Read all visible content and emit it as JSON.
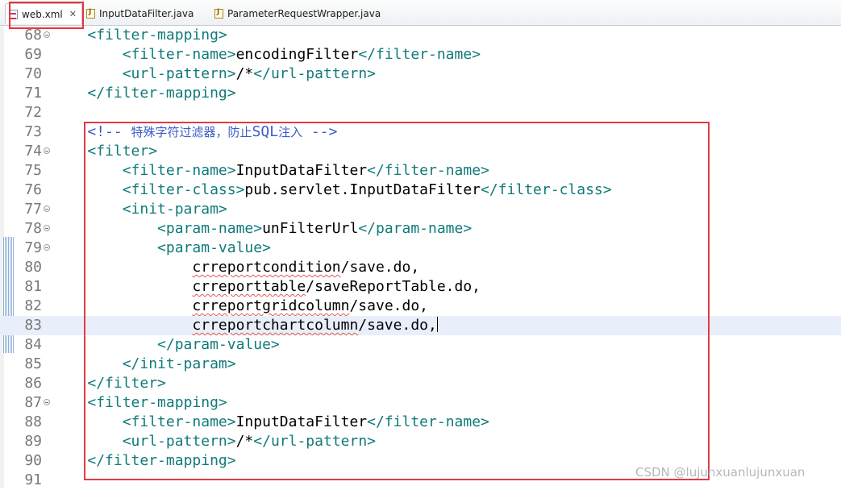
{
  "tabs": [
    {
      "label": "web.xml",
      "icon": "xml-file-icon",
      "close": "✕",
      "active": true
    },
    {
      "label": "InputDataFilter.java",
      "icon": "java-file-icon"
    },
    {
      "label": "ParameterRequestWrapper.java",
      "icon": "java-file-icon"
    }
  ],
  "editor": {
    "current_line": "83",
    "lines": [
      {
        "n": "68",
        "fold": true,
        "indent": "    ",
        "parts": [
          [
            "tag",
            "<filter-mapping>"
          ]
        ]
      },
      {
        "n": "69",
        "fold": false,
        "indent": "        ",
        "parts": [
          [
            "tag",
            "<filter-name>"
          ],
          [
            "txt",
            "encodingFilter"
          ],
          [
            "tag",
            "</filter-name>"
          ]
        ]
      },
      {
        "n": "70",
        "fold": false,
        "indent": "        ",
        "parts": [
          [
            "tag",
            "<url-pattern>"
          ],
          [
            "txt",
            "/*"
          ],
          [
            "tag",
            "</url-pattern>"
          ]
        ]
      },
      {
        "n": "71",
        "fold": false,
        "indent": "    ",
        "parts": [
          [
            "tag",
            "</filter-mapping>"
          ]
        ]
      },
      {
        "n": "72",
        "fold": false,
        "indent": "",
        "parts": []
      },
      {
        "n": "73",
        "fold": false,
        "indent": "    ",
        "parts": [
          [
            "cmt",
            "<!-- "
          ],
          [
            "cjk",
            "特殊字符过滤器，防止"
          ],
          [
            "cmt",
            "SQL"
          ],
          [
            "cjk",
            "注入"
          ],
          [
            "cmt",
            " -->"
          ]
        ]
      },
      {
        "n": "74",
        "fold": true,
        "indent": "    ",
        "parts": [
          [
            "tag",
            "<filter>"
          ]
        ]
      },
      {
        "n": "75",
        "fold": false,
        "indent": "        ",
        "parts": [
          [
            "tag",
            "<filter-name>"
          ],
          [
            "txt",
            "InputDataFilter"
          ],
          [
            "tag",
            "</filter-name>"
          ]
        ]
      },
      {
        "n": "76",
        "fold": false,
        "indent": "        ",
        "parts": [
          [
            "tag",
            "<filter-class>"
          ],
          [
            "txt",
            "pub.servlet.InputDataFilter"
          ],
          [
            "tag",
            "</filter-class>"
          ]
        ]
      },
      {
        "n": "77",
        "fold": true,
        "indent": "        ",
        "parts": [
          [
            "tag",
            "<init-param>"
          ]
        ]
      },
      {
        "n": "78",
        "fold": true,
        "indent": "            ",
        "parts": [
          [
            "tag",
            "<param-name>"
          ],
          [
            "txt",
            "unFilterUrl"
          ],
          [
            "tag",
            "</param-name>"
          ]
        ]
      },
      {
        "n": "79",
        "fold": true,
        "indent": "            ",
        "parts": [
          [
            "tag",
            "<param-value>"
          ]
        ]
      },
      {
        "n": "80",
        "fold": false,
        "indent": "                ",
        "parts": [
          [
            "sq",
            "crreportcondition"
          ],
          [
            "txt",
            "/save.do,"
          ]
        ]
      },
      {
        "n": "81",
        "fold": false,
        "indent": "                ",
        "parts": [
          [
            "sq",
            "crreporttable"
          ],
          [
            "txt",
            "/saveReportTable.do,"
          ]
        ]
      },
      {
        "n": "82",
        "fold": false,
        "indent": "                ",
        "parts": [
          [
            "sq",
            "crreportgridcolumn"
          ],
          [
            "txt",
            "/save.do,"
          ]
        ]
      },
      {
        "n": "83",
        "fold": false,
        "indent": "                ",
        "parts": [
          [
            "sq",
            "crreportchartcolumn"
          ],
          [
            "txt",
            "/save.do,"
          ],
          [
            "caret",
            ""
          ]
        ]
      },
      {
        "n": "84",
        "fold": false,
        "indent": "            ",
        "parts": [
          [
            "tag",
            "</param-value>"
          ]
        ]
      },
      {
        "n": "85",
        "fold": false,
        "indent": "        ",
        "parts": [
          [
            "tag",
            "</init-param>"
          ]
        ]
      },
      {
        "n": "86",
        "fold": false,
        "indent": "    ",
        "parts": [
          [
            "tag",
            "</filter>"
          ]
        ]
      },
      {
        "n": "87",
        "fold": true,
        "indent": "    ",
        "parts": [
          [
            "tag",
            "<filter-mapping>"
          ]
        ]
      },
      {
        "n": "88",
        "fold": false,
        "indent": "        ",
        "parts": [
          [
            "tag",
            "<filter-name>"
          ],
          [
            "txt",
            "InputDataFilter"
          ],
          [
            "tag",
            "</filter-name>"
          ]
        ]
      },
      {
        "n": "89",
        "fold": false,
        "indent": "        ",
        "parts": [
          [
            "tag",
            "<url-pattern>"
          ],
          [
            "txt",
            "/*"
          ],
          [
            "tag",
            "</url-pattern>"
          ]
        ]
      },
      {
        "n": "90",
        "fold": false,
        "indent": "    ",
        "parts": [
          [
            "tag",
            "</filter-mapping>"
          ]
        ]
      },
      {
        "n": "91",
        "fold": false,
        "indent": "",
        "parts": []
      }
    ]
  },
  "watermark": "CSDN @lujunxuanlujunxuan",
  "colors": {
    "annotation": "#e43a45",
    "tag": "#117a7a",
    "comment": "#3c5ac8",
    "text": "#000000",
    "current_line": "#e9effa"
  }
}
